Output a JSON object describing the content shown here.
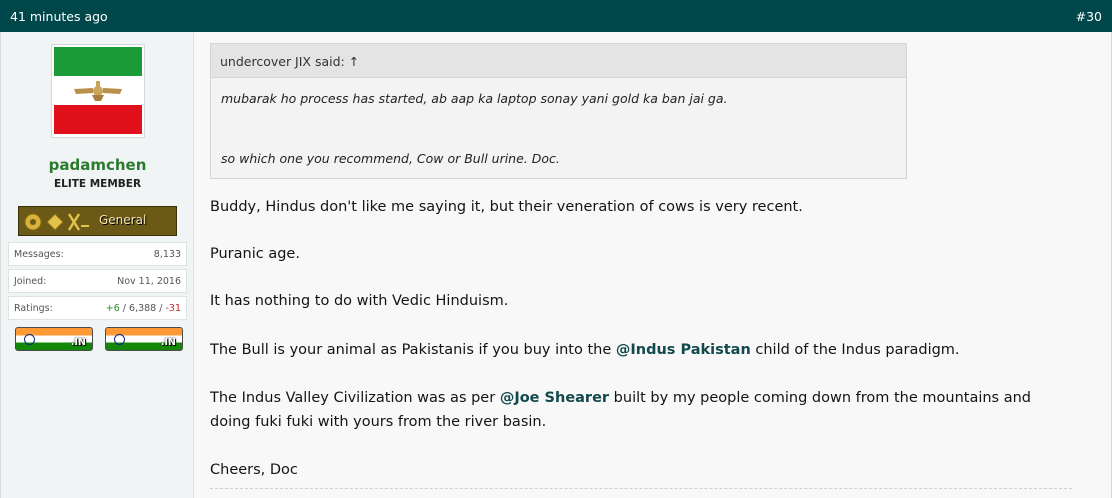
{
  "header": {
    "time": "41 minutes ago",
    "post_number": "#30"
  },
  "user": {
    "name": "padamchen",
    "title": "ELITE MEMBER",
    "rank": "General",
    "stats": [
      {
        "label": "Messages:",
        "value": "8,133"
      },
      {
        "label": "Joined:",
        "value": "Nov 11, 2016"
      }
    ],
    "ratings": {
      "label": "Ratings:",
      "positive": "+6",
      "sep1": " / ",
      "neutral": "6,388",
      "sep2": " / ",
      "negative": "-31"
    },
    "flags": [
      {
        "tld": ".IN"
      },
      {
        "tld": ".IN"
      }
    ]
  },
  "quote": {
    "attribution": "undercover JIX said: ↑",
    "lines": [
      "mubarak ho process has started, ab aap ka laptop sonay yani gold ka ban jai ga.",
      "so which one you recommend, Cow or Bull urine. Doc."
    ]
  },
  "body": {
    "p1": "Buddy, Hindus don't like me saying it, but their veneration of cows is very recent.",
    "p2": "Puranic age.",
    "p3": "It has nothing to do with Vedic Hinduism.",
    "p4": {
      "before": "The Bull is your animal as Pakistanis if you buy into the ",
      "mention": "@Indus Pakistan",
      "after": " child of the Indus paradigm."
    },
    "p5": {
      "before": "The Indus Valley Civilization was as per ",
      "mention": "@Joe Shearer",
      "after": " built by my people coming down from the mountains and",
      "line2": "doing fuki fuki with yours from the river basin."
    },
    "p6": "Cheers, Doc"
  },
  "colors": {
    "header_bg": "#00474c",
    "username": "#2b7a2e",
    "mention": "#11494c",
    "rating_positive": "#2e8b2e",
    "rating_negative": "#c22b2b"
  }
}
